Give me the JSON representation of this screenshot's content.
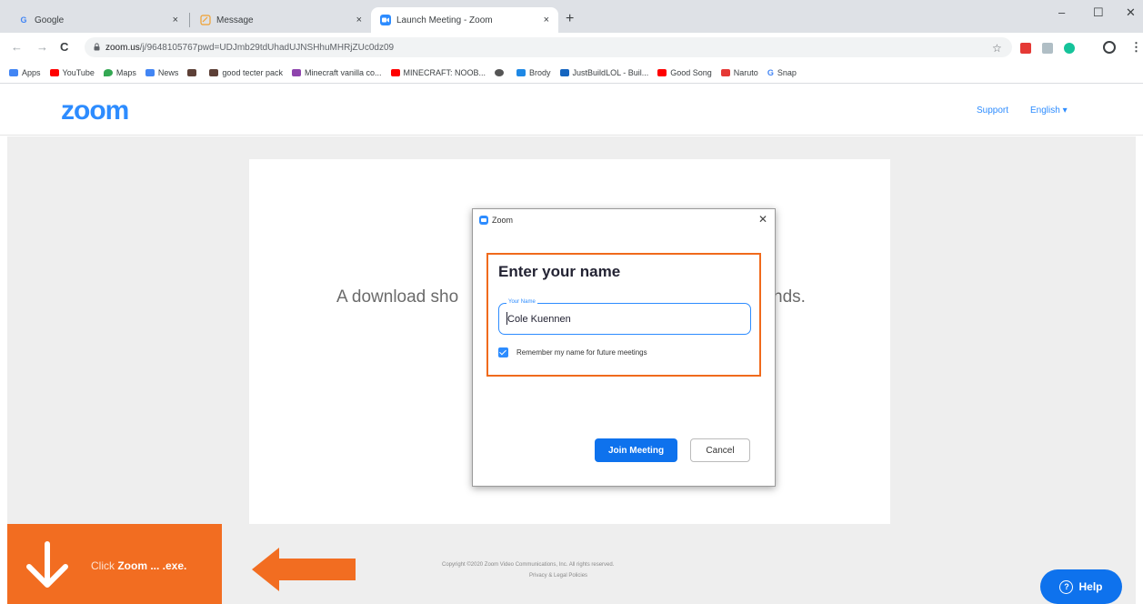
{
  "browser": {
    "tabs": [
      {
        "title": "Google",
        "favicon": "G",
        "favicon_color": "#4285f4"
      },
      {
        "title": "Message",
        "favicon": "message-icon",
        "favicon_color": "#f0a030"
      },
      {
        "title": "Launch Meeting - Zoom",
        "favicon": "zoom-icon",
        "favicon_color": "#2d8cff"
      }
    ],
    "tab_close": "×",
    "new_tab": "+",
    "window": {
      "minimize": "–",
      "maximize": "☐",
      "close": "✕"
    },
    "url": {
      "host": "zoom.us",
      "path": "/j/9648105767pwd=UDJmb29tdUhadUJNSHhuMHRjZUc0dz09"
    },
    "nav": {
      "back": "←",
      "forward": "→",
      "reload": "C"
    },
    "star": "☆",
    "menu": "⋮",
    "bookmarks": [
      {
        "label": "Apps",
        "color": "#4285f4"
      },
      {
        "label": "YouTube",
        "color": "#ff0000"
      },
      {
        "label": "Maps",
        "color": "#34a853"
      },
      {
        "label": "News",
        "color": "#4285f4"
      },
      {
        "label": "",
        "color": "#5d4037"
      },
      {
        "label": "good tecter pack",
        "color": "#5d4037"
      },
      {
        "label": "Minecraft vanilla co...",
        "color": "#8e44ad"
      },
      {
        "label": "MINECRAFT: NOOB...",
        "color": "#ff0000"
      },
      {
        "label": "",
        "color": "#555555"
      },
      {
        "label": "Brody",
        "color": "#1e88e5"
      },
      {
        "label": "JustBuildLOL - Buil...",
        "color": "#1565c0"
      },
      {
        "label": "Good Song",
        "color": "#ff0000"
      },
      {
        "label": "Naruto",
        "color": "#e53935"
      },
      {
        "label": "Snap",
        "color": "#4285f4"
      }
    ]
  },
  "page": {
    "logo": "zoom",
    "support": "Support",
    "language": "English ▾",
    "message_left": "A download sho",
    "message_right": "nds.",
    "copyright": "Copyright ©2020 Zoom Video Communications, Inc. All rights reserved.",
    "legal": "Privacy & Legal Policies",
    "help": "Help"
  },
  "dialog": {
    "title": "Zoom",
    "close": "✕",
    "heading": "Enter your name",
    "field_label": "Your Name",
    "field_value": "Cole Kuennen",
    "remember_label": "Remember my name for future meetings",
    "remember_checked": true,
    "join_label": "Join Meeting",
    "cancel_label": "Cancel"
  },
  "download_banner": {
    "prefix": "Click ",
    "filename": "Zoom ... .exe."
  },
  "colors": {
    "zoom_blue": "#2d8cff",
    "button_blue": "#0e72ed",
    "highlight_orange": "#f06a1c",
    "banner_orange": "#f26d21"
  }
}
